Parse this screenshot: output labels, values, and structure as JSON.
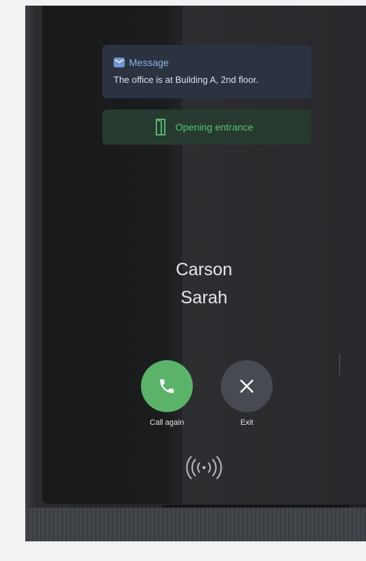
{
  "message": {
    "title": "Message",
    "text": "The office is at Building A, 2nd floor.",
    "icon": "message-envelope-icon"
  },
  "entrance": {
    "label": "Opening entrance",
    "icon": "door-icon",
    "color": "#58c074"
  },
  "caller": {
    "first": "Carson",
    "last": "Sarah"
  },
  "actions": {
    "call_again": "Call again",
    "exit": "Exit"
  },
  "colors": {
    "call_button": "#5bb369",
    "exit_button": "#474a51",
    "message_accent": "#8fb1e4"
  },
  "nfc_icon": "nfc-icon"
}
